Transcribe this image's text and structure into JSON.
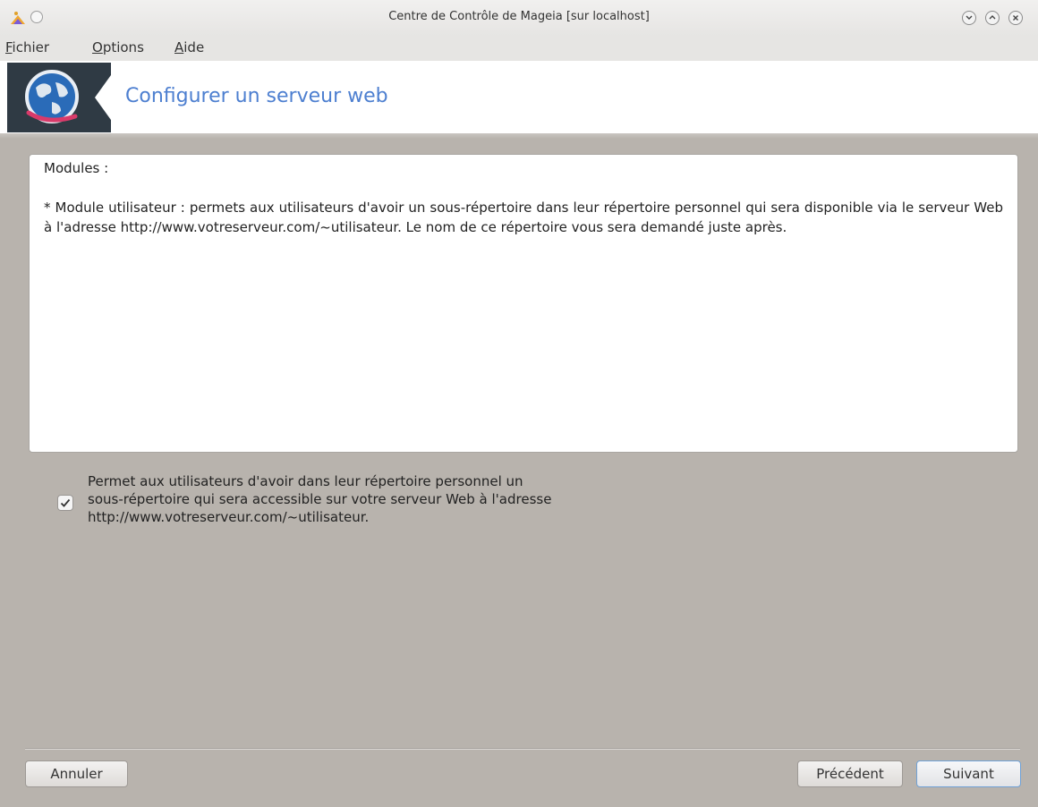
{
  "window": {
    "title": "Centre de Contrôle de Mageia  [sur localhost]",
    "app_icon": "mageia-icon"
  },
  "menubar": {
    "items": [
      {
        "mnemonic": "F",
        "rest": "ichier"
      },
      {
        "mnemonic": "O",
        "rest": "ptions"
      },
      {
        "mnemonic": "A",
        "rest": "ide"
      }
    ]
  },
  "banner": {
    "title": "Configurer un serveur web",
    "icon": "web-server-globe-icon"
  },
  "info": {
    "heading": "Modules :",
    "paragraph": "* Module utilisateur : permets aux utilisateurs d'avoir un sous-répertoire dans leur répertoire personnel qui sera disponible via le serveur Web à l'adresse http://www.votreserveur.com/~utilisateur.  Le nom de ce répertoire vous sera demandé juste après."
  },
  "option": {
    "checked": true,
    "lines": [
      "Permet aux utilisateurs d'avoir dans leur répertoire personnel un",
      "sous-répertoire qui sera accessible sur votre serveur Web à l'adresse",
      "http://www.votreserveur.com/~utilisateur."
    ]
  },
  "buttons": {
    "cancel": "Annuler",
    "previous": "Précédent",
    "next": "Suivant"
  },
  "colors": {
    "accent": "#4d7fd0",
    "background": "#b8b3ad"
  }
}
